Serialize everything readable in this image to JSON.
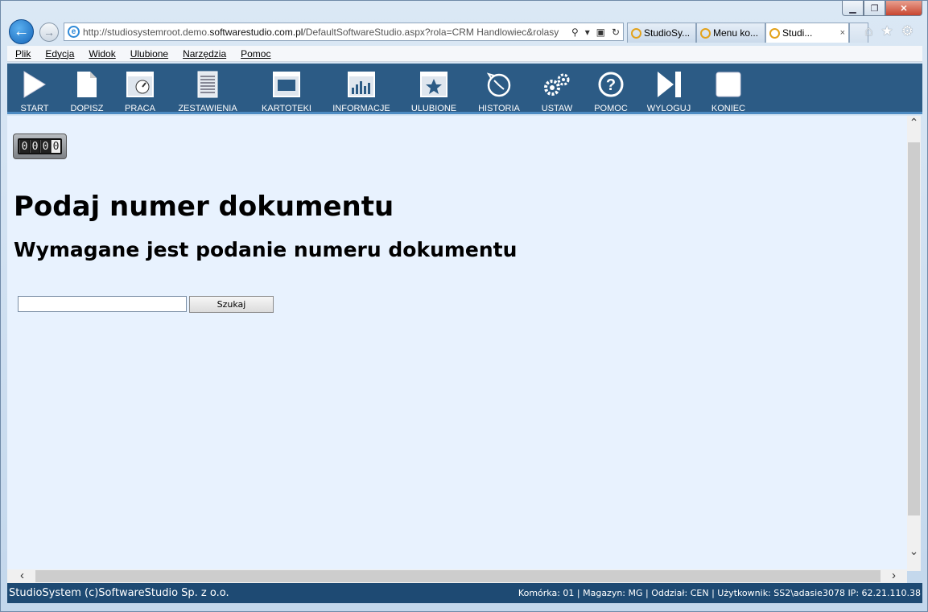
{
  "browser": {
    "url_prefix": "http://studiosystemroot.demo.",
    "url_domain": "softwarestudio.com.pl",
    "url_rest": "/DefaultSoftwareStudio.aspx?rola=CRM Handlowiec&rolasy",
    "tabs": [
      {
        "title": "StudioSy..."
      },
      {
        "title": "Menu ko..."
      },
      {
        "title": "Studi...",
        "close": "×"
      }
    ]
  },
  "menu": [
    "Plik",
    "Edycja",
    "Widok",
    "Ulubione",
    "Narzędzia",
    "Pomoc"
  ],
  "toolbar": [
    {
      "label": "START",
      "icon": "play-icon"
    },
    {
      "label": "DOPISZ",
      "icon": "new-document-icon"
    },
    {
      "label": "PRACA",
      "icon": "work-gauge-icon"
    },
    {
      "label": "ZESTAWIENIA",
      "icon": "report-sheet-icon"
    },
    {
      "label": "KARTOTEKI",
      "icon": "window-card-icon"
    },
    {
      "label": "INFORMACJE",
      "icon": "bar-chart-icon"
    },
    {
      "label": "ULUBIONE",
      "icon": "star-window-icon"
    },
    {
      "label": "HISTORIA",
      "icon": "history-clock-icon"
    },
    {
      "label": "USTAW",
      "icon": "gears-icon"
    },
    {
      "label": "POMOC",
      "icon": "help-question-icon"
    },
    {
      "label": "WYLOGUJ",
      "icon": "skip-forward-icon"
    },
    {
      "label": "KONIEC",
      "icon": "stop-square-icon"
    }
  ],
  "counter": [
    "0",
    "0",
    "0",
    "0"
  ],
  "main": {
    "heading": "Podaj numer dokumentu",
    "subheading": "Wymagane jest podanie numeru dokumentu",
    "search_value": "",
    "search_button": "Szukaj"
  },
  "status": {
    "left": "StudioSystem (c)SoftwareStudio Sp. z o.o.",
    "right": "Komórka: 01 | Magazyn: MG | Oddział: CEN | Użytkownik: SS2\\adasie3078 IP: 62.21.110.38"
  }
}
